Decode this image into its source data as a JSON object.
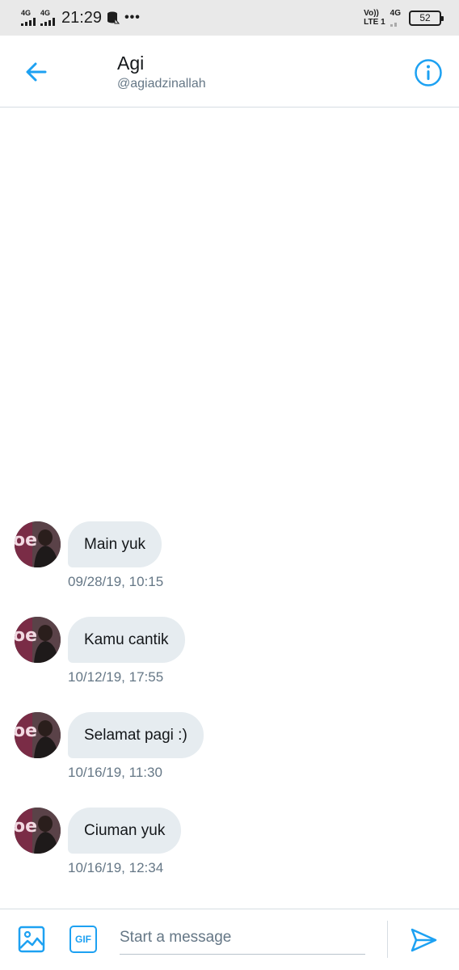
{
  "status_bar": {
    "sim1_network": "4G",
    "sim2_network": "4G",
    "time": "21:29",
    "volte_top": "Vo))",
    "volte_bottom": "LTE 1",
    "data_network": "4G",
    "battery": "52"
  },
  "header": {
    "name": "Agi",
    "handle": "@agiadzinallah",
    "back_icon": "arrow-left-icon",
    "info_icon": "info-circle-icon"
  },
  "messages": [
    {
      "text": "Main yuk",
      "timestamp": "09/28/19, 10:15"
    },
    {
      "text": "Kamu cantik",
      "timestamp": "10/12/19, 17:55"
    },
    {
      "text": "Selamat pagi :)",
      "timestamp": "10/16/19, 11:30"
    },
    {
      "text": "Ciuman yuk",
      "timestamp": "10/16/19, 12:34"
    }
  ],
  "composer": {
    "placeholder": "Start a message",
    "gif_label": "GIF"
  },
  "colors": {
    "accent": "#1da1f2",
    "bubble": "#e6ecf0",
    "secondary_text": "#657786",
    "status_bar": "#e9e9e9"
  }
}
